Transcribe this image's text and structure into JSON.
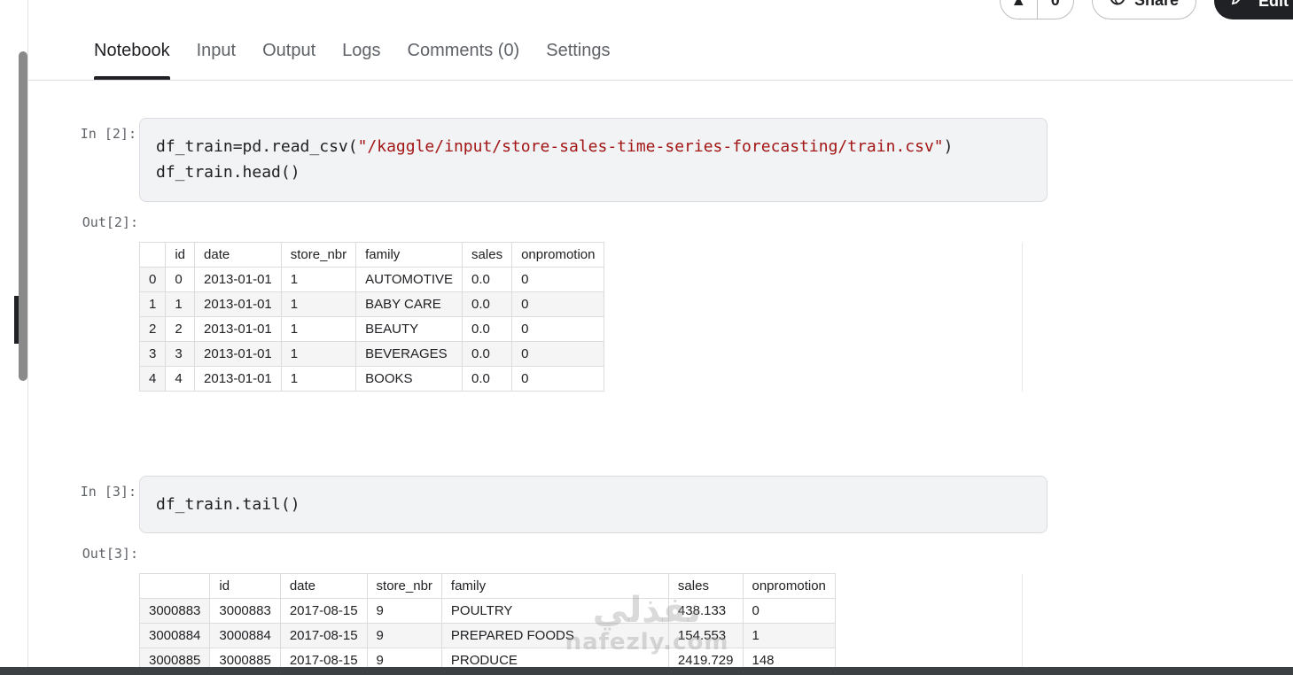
{
  "header": {
    "vote_count": "0",
    "share_label": "Share",
    "edit_label": "Edit"
  },
  "tabs": [
    {
      "label": "Notebook",
      "active": true
    },
    {
      "label": "Input"
    },
    {
      "label": "Output"
    },
    {
      "label": "Logs"
    },
    {
      "label": "Comments (0)"
    },
    {
      "label": "Settings"
    }
  ],
  "cell1": {
    "in_prompt": "In [2]:",
    "out_prompt": "Out[2]:",
    "code_line1_pre": "df_train=pd.read_csv(",
    "code_line1_str": "\"/kaggle/input/store-sales-time-series-forecasting/train.csv\"",
    "code_line1_post": ")",
    "code_line2": "df_train.head()",
    "table": {
      "columns": [
        "",
        "id",
        "date",
        "store_nbr",
        "family",
        "sales",
        "onpromotion"
      ],
      "rows": [
        [
          "0",
          "0",
          "2013-01-01",
          "1",
          "AUTOMOTIVE",
          "0.0",
          "0"
        ],
        [
          "1",
          "1",
          "2013-01-01",
          "1",
          "BABY CARE",
          "0.0",
          "0"
        ],
        [
          "2",
          "2",
          "2013-01-01",
          "1",
          "BEAUTY",
          "0.0",
          "0"
        ],
        [
          "3",
          "3",
          "2013-01-01",
          "1",
          "BEVERAGES",
          "0.0",
          "0"
        ],
        [
          "4",
          "4",
          "2013-01-01",
          "1",
          "BOOKS",
          "0.0",
          "0"
        ]
      ]
    }
  },
  "cell2": {
    "in_prompt": "In [3]:",
    "out_prompt": "Out[3]:",
    "code_line1": "df_train.tail()",
    "table": {
      "columns": [
        "",
        "id",
        "date",
        "store_nbr",
        "family",
        "sales",
        "onpromotion"
      ],
      "rows": [
        [
          "3000883",
          "3000883",
          "2017-08-15",
          "9",
          "POULTRY",
          "438.133",
          "0"
        ],
        [
          "3000884",
          "3000884",
          "2017-08-15",
          "9",
          "PREPARED FOODS",
          "154.553",
          "1"
        ],
        [
          "3000885",
          "3000885",
          "2017-08-15",
          "9",
          "PRODUCE",
          "2419.729",
          "148"
        ]
      ]
    }
  },
  "watermark": {
    "arabic": "نفذلي",
    "latin": "nafezly.com"
  }
}
